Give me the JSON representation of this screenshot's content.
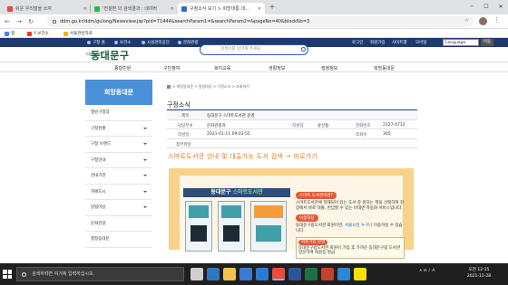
{
  "browser": {
    "tabs": [
      {
        "title": "쉬운 우리말을 쓰자",
        "favicon_color": "#e8473c"
      },
      {
        "title": "'전설편 의 검색결과 : 네이버",
        "favicon_color": "#19c24a"
      },
      {
        "title": "구정소식 보기 > 희망대통 대…",
        "favicon_color": "#2d6bd1"
      }
    ],
    "new_tab_icon": "+",
    "url": "ddm.go.kr/ddm/gulong/Newsview.jsp?pid=71444&searchParam1=&searchParam2=&pageNo=40&blockNo=3",
    "bookmarks": [
      {
        "label": "앱",
        "color": "#4285f4"
      },
      {
        "label": "Y  보건소",
        "color": "#e53935"
      },
      {
        "label": "서울관련자료",
        "color": "#f4b400"
      }
    ]
  },
  "site": {
    "util_links": [
      "구청 홈",
      "보건소",
      "시설관리공단",
      "문화관광"
    ],
    "util_right": [
      "로그인",
      "회원가입",
      "사이트맵",
      "모바일"
    ],
    "language_select": "Language",
    "language_button": "이동",
    "logo_text": "동대문구",
    "logo_small": "서울의 미래",
    "search_placeholder": "검색어를 입력해 주세요",
    "main_nav": [
      "종합민원",
      "구민참여",
      "복지교육",
      "생활정보",
      "행정정보",
      "희망동대문"
    ]
  },
  "sidebar": {
    "title": "희망동대문",
    "items": [
      {
        "label": "열린구청장",
        "has_arrow": false
      },
      {
        "label": "구청현황",
        "has_arrow": true
      },
      {
        "label": "구청 브랜드",
        "has_arrow": true
      },
      {
        "label": "구청안내",
        "has_arrow": true
      },
      {
        "label": "관내기관",
        "has_arrow": true
      },
      {
        "label": "자매도시",
        "has_arrow": true
      },
      {
        "label": "알림마당",
        "has_arrow": true
      },
      {
        "label": "문화관광",
        "has_arrow": false
      },
      {
        "label": "행정동대문",
        "has_arrow": false
      }
    ]
  },
  "content": {
    "breadcrumb": "> 희망동대문 > 알림마당 > 구정소식 > 조회하기",
    "page_title": "구정소식",
    "table": {
      "title_label": "제목",
      "title_value": "동대문구 스마트도서관 운영",
      "dept_label": "담당부서",
      "dept_value": "문화관광과",
      "author_label": "작성자",
      "author_value": "윤선형",
      "phone_label": "전화번호",
      "phone_value": "2127-4712",
      "date_label": "작성일",
      "date_value": "2021-01-11 09:03:55",
      "views_label": "조회수",
      "views_value": "305",
      "attach_label": "첨부파일"
    },
    "highlight": "스마트도서관 안내 및 대출가능 도서 검색 → 바로가기"
  },
  "poster": {
    "head_prefix": "동대문구",
    "head_accent": "스마트도서관",
    "badge1": "스마트 도서관이란?",
    "text1": "스마트도서관에 적재되어 있는 도서 중 원하는 책을 선택하여 현장에서 바로 대출, 반납할 수 있는 비대면 자동화 서비스입니다.",
    "badge2": "이용대상",
    "text2_a": "동대문구립도서관 회원이면,",
    "text2_b": "서울시민 누구나",
    "text2_c": "이용하실 수 있습니다.",
    "box_badge": "회원가입 방법",
    "box_text": "동대문구립도서관 회원이 가입 후 가까운 동대문구립 도서관 방문하여 회원증 발급"
  },
  "taskbar": {
    "search_placeholder": "검색하려면 여기에 입력하십시오.",
    "apps": [
      {
        "name": "task-view",
        "color": "#cfcfcf"
      },
      {
        "name": "edge",
        "color": "#3277bc"
      },
      {
        "name": "explorer",
        "color": "#f2c14e"
      },
      {
        "name": "store",
        "color": "#3a7bd5"
      },
      {
        "name": "mail",
        "color": "#2b7bd6"
      },
      {
        "name": "chrome",
        "color": "#e74c3c"
      },
      {
        "name": "word",
        "color": "#2b5797"
      },
      {
        "name": "excel",
        "color": "#1e7145"
      },
      {
        "name": "powerpoint",
        "color": "#c4412a"
      },
      {
        "name": "hangul",
        "color": "#2b88d8"
      },
      {
        "name": "kakaotalk",
        "color": "#f9e000"
      }
    ],
    "tray": "∧  ⊡  ♪  A",
    "time": "오전 12:15",
    "date": "2021-11-28"
  }
}
